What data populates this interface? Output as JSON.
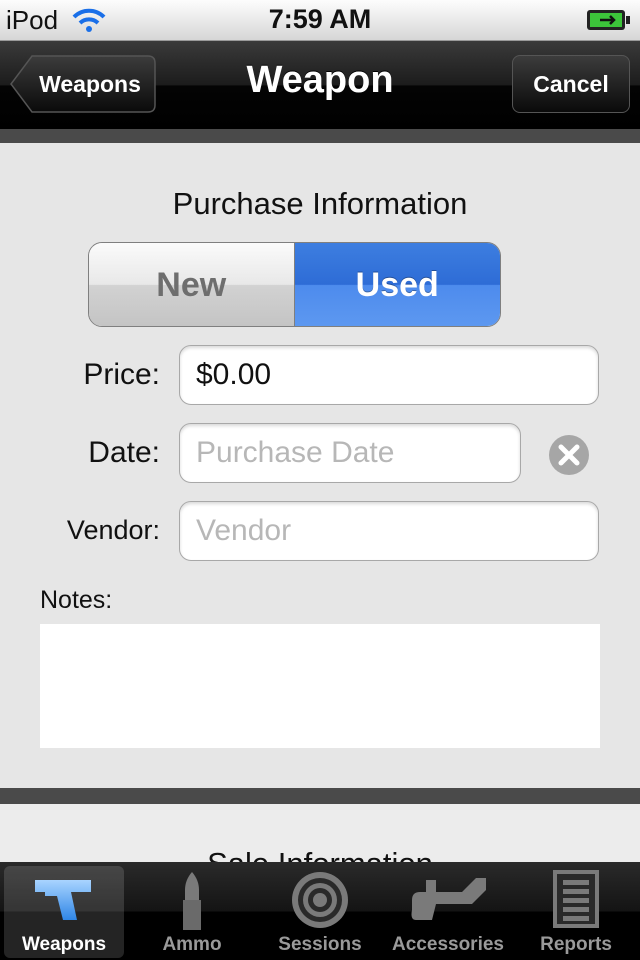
{
  "status_bar": {
    "carrier": "iPod",
    "time": "7:59 AM"
  },
  "nav": {
    "back_label": "Weapons",
    "title": "Weapon",
    "cancel_label": "Cancel"
  },
  "purchase": {
    "title": "Purchase Information",
    "segments": [
      "New",
      "Used"
    ],
    "selected_segment": "Used",
    "price_label": "Price:",
    "price_value": "$0.00",
    "date_label": "Date:",
    "date_placeholder": "Purchase Date",
    "vendor_label": "Vendor:",
    "vendor_placeholder": "Vendor",
    "notes_label": "Notes:"
  },
  "sale": {
    "title": "Sale Information"
  },
  "tabs": [
    {
      "label": "Weapons",
      "icon": "pistol-icon",
      "active": true
    },
    {
      "label": "Ammo",
      "icon": "bullet-icon",
      "active": false
    },
    {
      "label": "Sessions",
      "icon": "target-icon",
      "active": false
    },
    {
      "label": "Accessories",
      "icon": "accessory-icon",
      "active": false
    },
    {
      "label": "Reports",
      "icon": "report-icon",
      "active": false
    }
  ],
  "colors": {
    "accent": "#2e6cd6",
    "nav_bg": "#000000",
    "content_bg": "#e6e6e6"
  }
}
